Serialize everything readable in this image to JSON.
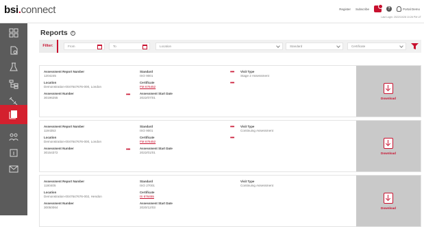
{
  "app": {
    "logo_bold": "bsi",
    "logo_dot": ".",
    "logo_rest": "connect"
  },
  "header": {
    "links": [
      "Register",
      "Subscribe"
    ],
    "user": "Portal Demo",
    "last_login": "Last Login: 2022/10/28 10:28 PM UT"
  },
  "sidebar": {
    "items": [
      {
        "name": "dashboard-icon",
        "active": false
      },
      {
        "name": "documents-icon",
        "active": false
      },
      {
        "name": "lab-icon",
        "active": false
      },
      {
        "name": "hierarchy-icon",
        "active": false
      },
      {
        "name": "tools-icon",
        "active": false
      },
      {
        "name": "reports-icon",
        "active": true
      },
      {
        "name": "people-icon",
        "active": false
      },
      {
        "name": "info-panel-icon",
        "active": false
      },
      {
        "name": "mail-icon",
        "active": false
      }
    ]
  },
  "page": {
    "title": "Reports",
    "info_glyph": "i"
  },
  "filter": {
    "label": "Filter:",
    "from_placeholder": "From",
    "to_placeholder": "To",
    "location_placeholder": "Location",
    "standard_placeholder": "Standard",
    "certificate_placeholder": "Certificate"
  },
  "labels": {
    "report_number": "Assessment Report Number",
    "location": "Location",
    "assessment_number": "Assessment Number",
    "standard": "Standard",
    "certificate": "Certificate",
    "start_date": "Assessment Start Date",
    "visit_type": "Visit Type",
    "download": "Download",
    "dots": "•••"
  },
  "reports": [
    {
      "report_number": "1204245",
      "location": "Demonstration-0047647676-000, London",
      "assessment_number": "30196255",
      "standard": "ISO 9001",
      "certificate": "FM 676452",
      "start_date": "2022/07/01",
      "visit_type": "Stage 2 Assessment"
    },
    {
      "report_number": "1194353",
      "location": "Demonstration-0047647676-000, London",
      "assessment_number": "30154372",
      "standard": "ISO 9001",
      "certificate": "FM 676452",
      "start_date": "2022/01/01",
      "visit_type": "Continuing Assessment"
    },
    {
      "report_number": "1180405",
      "location": "Demonstration-0047647676-002, Hendon",
      "assessment_number": "30050064",
      "standard": "ISO 27001",
      "certificate": "IS 676455",
      "start_date": "2020/12/03",
      "visit_type": "Continuing Assessment"
    }
  ],
  "colors": {
    "accent": "#c8102e",
    "sidebar": "#5b5b5b",
    "download_panel": "#c9c9c9"
  }
}
